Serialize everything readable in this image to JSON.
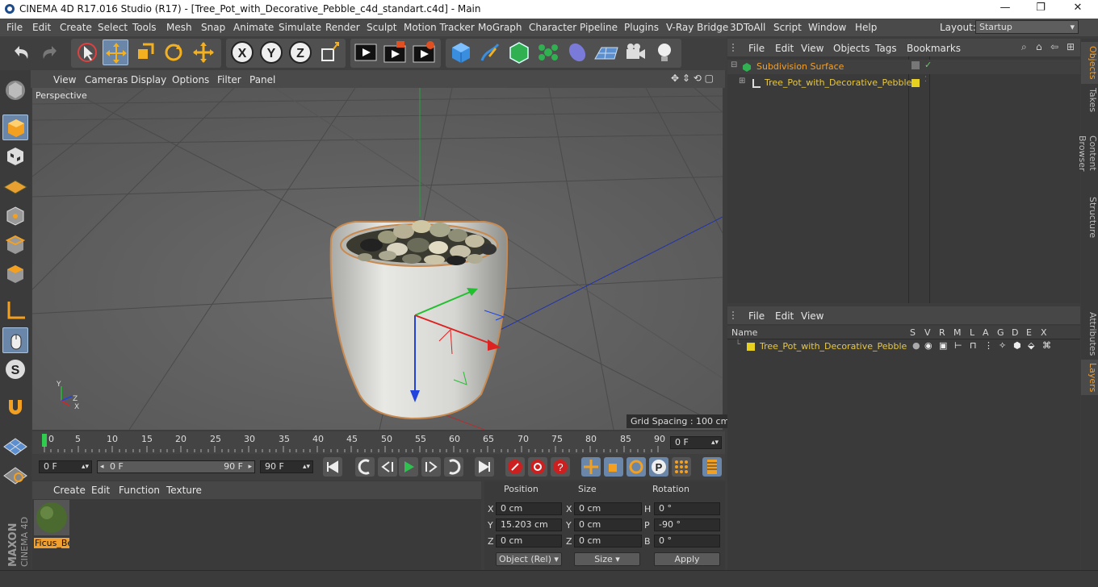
{
  "window": {
    "title": "CINEMA 4D R17.016 Studio (R17) - [Tree_Pot_with_Decorative_Pebble_c4d_standart.c4d] - Main",
    "minimize": "—",
    "maximize": "❐",
    "close": "✕"
  },
  "menu": [
    "File",
    "Edit",
    "Create",
    "Select",
    "Tools",
    "Mesh",
    "Snap",
    "Animate",
    "Simulate",
    "Render",
    "Sculpt",
    "Motion Tracker",
    "MoGraph",
    "Character",
    "Pipeline",
    "Plugins",
    "V-Ray Bridge",
    "3DToAll",
    "Script",
    "Window",
    "Help"
  ],
  "layout": {
    "label": "Layout:",
    "value": "Startup"
  },
  "viewport": {
    "menu": [
      "View",
      "Cameras",
      "Display",
      "Options",
      "Filter",
      "Panel"
    ],
    "label": "Perspective",
    "grid_spacing": "Grid Spacing : 100 cm",
    "axis_labels": {
      "x": "X",
      "y": "Y",
      "z": "Z"
    }
  },
  "timeline": {
    "ticks": [
      "0",
      "5",
      "10",
      "15",
      "20",
      "25",
      "30",
      "35",
      "40",
      "45",
      "50",
      "55",
      "60",
      "65",
      "70",
      "75",
      "80",
      "85",
      "90"
    ],
    "current_frame": "0 F"
  },
  "playback": {
    "start": "0 F",
    "range_start": "0 F",
    "range_end": "90 F",
    "end": "90 F"
  },
  "material_manager": {
    "menu": [
      "Create",
      "Edit",
      "Function",
      "Texture"
    ],
    "materials": [
      {
        "name": "Ficus_Be"
      }
    ]
  },
  "coordinates": {
    "headers": {
      "position": "Position",
      "size": "Size",
      "rotation": "Rotation"
    },
    "rows": [
      {
        "axis": "X",
        "pos": "0 cm",
        "size_axis": "X",
        "size": "0 cm",
        "rot_axis": "H",
        "rot": "0 °"
      },
      {
        "axis": "Y",
        "pos": "15.203 cm",
        "size_axis": "Y",
        "size": "0 cm",
        "rot_axis": "P",
        "rot": "-90 °"
      },
      {
        "axis": "Z",
        "pos": "0 cm",
        "size_axis": "Z",
        "size": "0 cm",
        "rot_axis": "B",
        "rot": "0 °"
      }
    ],
    "mode": "Object (Rel)",
    "size_mode": "Size",
    "apply": "Apply"
  },
  "object_manager": {
    "menu": [
      "File",
      "Edit",
      "View",
      "Objects",
      "Tags",
      "Bookmarks"
    ],
    "objects": [
      {
        "name": "Subdivision Surface",
        "indent": 0
      },
      {
        "name": "Tree_Pot_with_Decorative_Pebble",
        "indent": 1
      }
    ]
  },
  "layer_manager": {
    "menu": [
      "File",
      "Edit",
      "View"
    ],
    "columns": [
      "Name",
      "S",
      "V",
      "R",
      "M",
      "L",
      "A",
      "G",
      "D",
      "E",
      "X"
    ],
    "layers": [
      {
        "name": "Tree_Pot_with_Decorative_Pebble"
      }
    ]
  },
  "right_tabs": [
    "Objects",
    "Takes",
    "Content Browser",
    "Structure",
    "Attributes",
    "Layers"
  ],
  "brand": {
    "line1": "MAXON",
    "line2": "CINEMA 4D"
  },
  "colors": {
    "accent": "#6a86a8",
    "layer": "#e8d020",
    "object": "#f0a030"
  }
}
